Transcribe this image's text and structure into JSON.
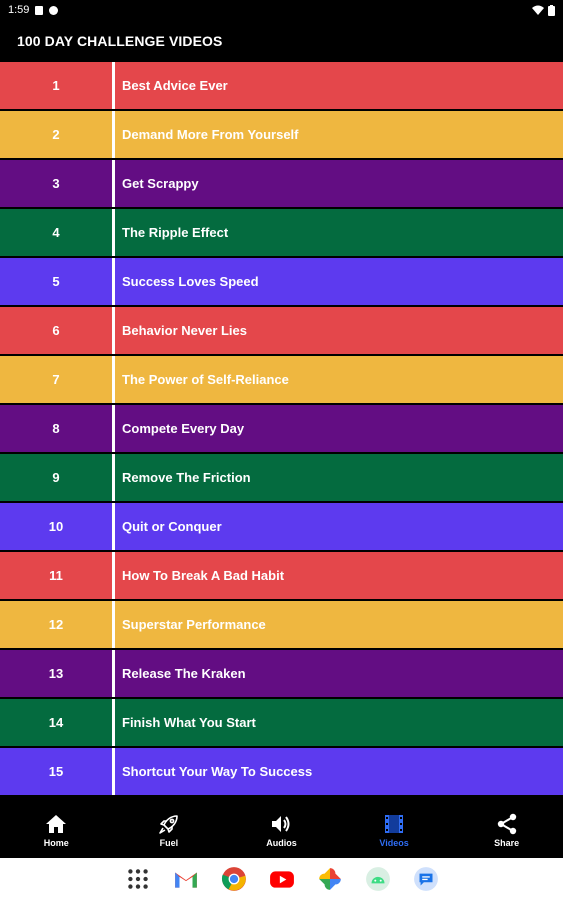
{
  "status": {
    "time": "1:59"
  },
  "app": {
    "title": "100 DAY CHALLENGE VIDEOS"
  },
  "colors": {
    "red": "#e4474b",
    "yellow": "#efb740",
    "purple": "#630d83",
    "green": "#046b3f",
    "blue": "#5d3aef",
    "accent": "#2f6df4"
  },
  "videos": [
    {
      "num": "1",
      "title": "Best Advice Ever",
      "color": "#e4474b"
    },
    {
      "num": "2",
      "title": "Demand More From Yourself",
      "color": "#efb740"
    },
    {
      "num": "3",
      "title": "Get Scrappy",
      "color": "#630d83"
    },
    {
      "num": "4",
      "title": "The Ripple Effect",
      "color": "#046b3f"
    },
    {
      "num": "5",
      "title": "Success Loves Speed",
      "color": "#5d3aef"
    },
    {
      "num": "6",
      "title": "Behavior Never Lies",
      "color": "#e4474b"
    },
    {
      "num": "7",
      "title": "The Power of Self-Reliance",
      "color": "#efb740"
    },
    {
      "num": "8",
      "title": "Compete Every Day",
      "color": "#630d83"
    },
    {
      "num": "9",
      "title": "Remove The Friction",
      "color": "#046b3f"
    },
    {
      "num": "10",
      "title": "Quit or Conquer",
      "color": "#5d3aef"
    },
    {
      "num": "11",
      "title": "How To Break A Bad Habit",
      "color": "#e4474b"
    },
    {
      "num": "12",
      "title": "Superstar Performance",
      "color": "#efb740"
    },
    {
      "num": "13",
      "title": "Release The Kraken",
      "color": "#630d83"
    },
    {
      "num": "14",
      "title": "Finish What You Start",
      "color": "#046b3f"
    },
    {
      "num": "15",
      "title": "Shortcut Your Way To Success",
      "color": "#5d3aef"
    }
  ],
  "nav": [
    {
      "label": "Home",
      "icon": "home-icon"
    },
    {
      "label": "Fuel",
      "icon": "rocket-icon"
    },
    {
      "label": "Audios",
      "icon": "volume-icon"
    },
    {
      "label": "Videos",
      "icon": "video-icon",
      "active": true
    },
    {
      "label": "Share",
      "icon": "share-icon"
    }
  ],
  "taskbar": [
    "apps-grid-icon",
    "gmail-icon",
    "chrome-icon",
    "youtube-icon",
    "photos-icon",
    "android-icon",
    "messages-icon"
  ]
}
